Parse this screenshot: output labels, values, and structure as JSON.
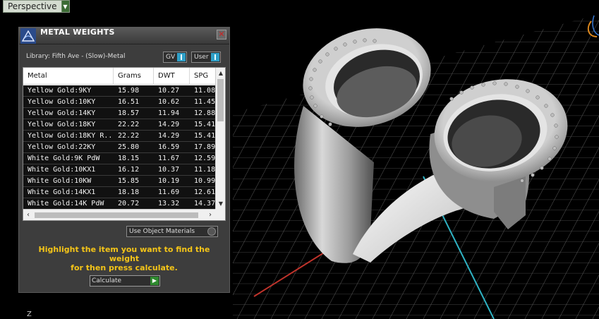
{
  "viewport": {
    "tab_label": "Perspective",
    "axis_label": "Z"
  },
  "panel": {
    "title": "METAL WEIGHTS",
    "library": "Library: Fifth Ave - (Slow)-Metal",
    "toggle_gv": "GV",
    "toggle_user": "User",
    "columns": [
      "Metal",
      "Grams",
      "DWT",
      "SPG"
    ],
    "rows": [
      [
        "Yellow Gold:9KY",
        "15.98",
        "10.27",
        "11.08"
      ],
      [
        "Yellow Gold:10KY",
        "16.51",
        "10.62",
        "11.45"
      ],
      [
        "Yellow Gold:14KY",
        "18.57",
        "11.94",
        "12.88"
      ],
      [
        "Yellow Gold:18KY",
        "22.22",
        "14.29",
        "15.41"
      ],
      [
        "Yellow Gold:18KY R...",
        "22.22",
        "14.29",
        "15.41"
      ],
      [
        "Yellow Gold:22KY",
        "25.80",
        "16.59",
        "17.89"
      ],
      [
        "White Gold:9K PdW",
        "18.15",
        "11.67",
        "12.59"
      ],
      [
        "White Gold:10KX1",
        "16.12",
        "10.37",
        "11.18"
      ],
      [
        "White Gold:10KW",
        "15.85",
        "10.19",
        "10.99"
      ],
      [
        "White Gold:14KX1",
        "18.18",
        "11.69",
        "12.61"
      ],
      [
        "White Gold:14K PdW",
        "20.72",
        "13.32",
        "14.37"
      ]
    ],
    "use_object_materials": "Use Object Materials",
    "hint_line1": "Highlight the item you want to find the weight",
    "hint_line2": "for then press calculate.",
    "calculate_label": "Calculate"
  },
  "colors": {
    "hint": "#f5c518",
    "toggle_indicator": "#2fa0c8",
    "calculate_go": "#2f8a2f"
  }
}
